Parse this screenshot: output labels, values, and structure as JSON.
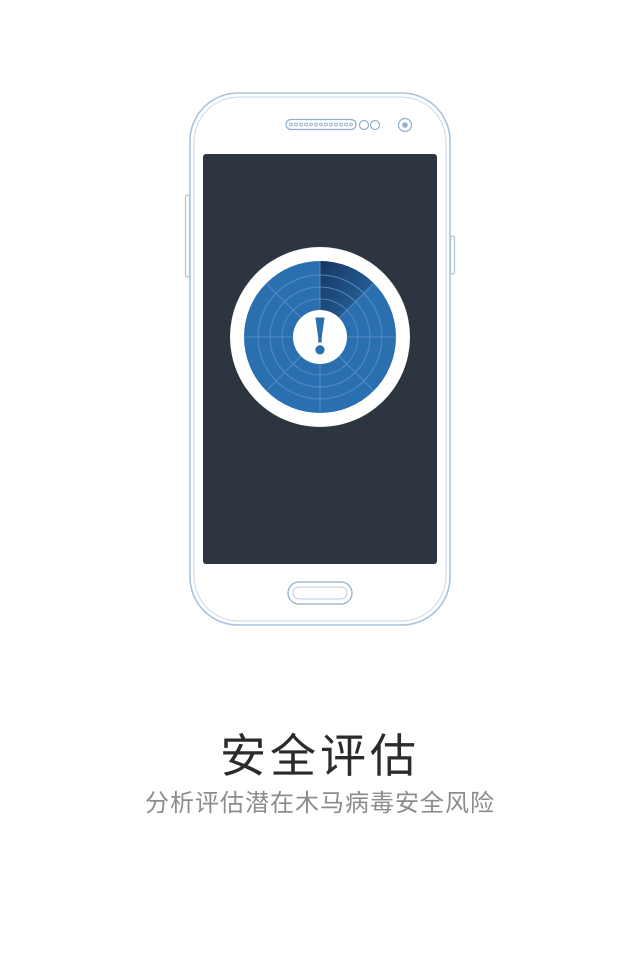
{
  "onboarding": {
    "title": "安全评估",
    "subtitle": "分析评估潜在木马病毒安全风险"
  },
  "illustration": {
    "icon": "warning-radar-icon",
    "exclamation": "!",
    "colors": {
      "phone_outline": "#a9c3dd",
      "screen": "#2d3640",
      "radar_blue": "#2a6fb0",
      "radar_ring": "#ffffff",
      "sweep_dark": "#1a3b66"
    }
  }
}
